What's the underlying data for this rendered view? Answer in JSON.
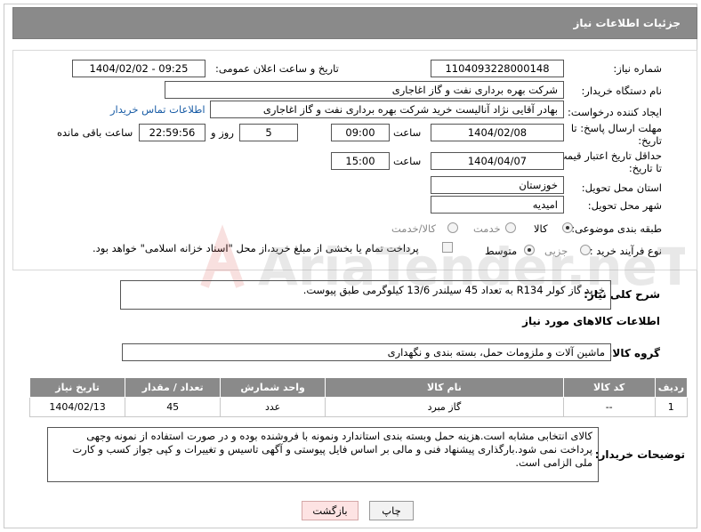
{
  "header": {
    "title": "جزئیات اطلاعات نیاز"
  },
  "form": {
    "need_number_label": "شماره نیاز:",
    "need_number": "1104093228000148",
    "announce_label": "تاریخ و ساعت اعلان عمومی:",
    "announce_value": "1404/02/02 - 09:25",
    "buyer_org_label": "نام دستگاه خریدار:",
    "buyer_org": "شرکت بهره برداری نفت و گاز اغاجاری",
    "creator_label": "ایجاد کننده درخواست:",
    "creator": "بهادر  آقایی نژاد آنالیست خرید شرکت بهره برداری نفت و گاز اغاجاری",
    "contact_link": "اطلاعات تماس خریدار",
    "reply_deadline_label_1": "مهلت ارسال پاسخ: تا",
    "reply_deadline_label_2": "تاریخ:",
    "reply_date": "1404/02/08",
    "time_label": "ساعت",
    "reply_time": "09:00",
    "days_value": "5",
    "days_label": "روز و",
    "remaining_time": "22:59:56",
    "remaining_label": "ساعت باقی مانده",
    "validity_label_1": "حداقل تاریخ اعتبار قیمت:",
    "validity_label_2": "تا تاریخ:",
    "validity_date": "1404/04/07",
    "validity_time": "15:00",
    "province_label": "استان محل تحویل:",
    "province": "خوزستان",
    "city_label": "شهر محل تحویل:",
    "city": "امیدیه",
    "category_label": "طبقه بندی موضوعی:",
    "category_options": [
      "کالا",
      "خدمت",
      "کالا/خدمت"
    ],
    "category_selected": "کالا",
    "process_label": "نوع فرآیند خرید :",
    "process_options": [
      "جزیی",
      "متوسط"
    ],
    "process_selected": "متوسط",
    "payment_note": "پرداخت تمام یا بخشی از مبلغ خرید،از محل \"اسناد خزانه اسلامی\" خواهد بود."
  },
  "description": {
    "label": "شرح کلی نیاز:",
    "text": "خرید گاز کولر R134 به تعداد 45 سیلندر 13/6 کیلوگرمی طبق پیوست."
  },
  "goods_section": {
    "title": "اطلاعات کالاهای مورد نیاز",
    "group_label": "گروه کالا:",
    "group_value": "ماشین آلات و ملزومات حمل، بسته بندی و نگهداری"
  },
  "table": {
    "headers": [
      "ردیف",
      "کد کالا",
      "نام کالا",
      "واحد شمارش",
      "تعداد / مقدار",
      "تاریخ نیاز"
    ],
    "rows": [
      [
        "1",
        "--",
        "گاز مبرد",
        "عدد",
        "45",
        "1404/02/13"
      ]
    ]
  },
  "notes": {
    "label": "توضیحات خریدار:",
    "text": "کالای انتخابی مشابه است.هزینه حمل وبسته بندی استاندارد ونمونه با فروشنده بوده و در صورت استفاده از نمونه وجهی پرداخت نمی شود.بارگذاری پیشنهاد فنی و مالی بر اساس فایل پیوستی و آگهی تاسیس و تغییرات و کپی جواز کسب و کارت ملی الزامی است."
  },
  "buttons": {
    "print": "چاپ",
    "back": "بازگشت"
  },
  "watermark": {
    "brand": "AriaTender.neT"
  },
  "colors": {
    "header_bg": "#8a8a8a",
    "link": "#1a5da6",
    "watermark": "#d9534f"
  }
}
